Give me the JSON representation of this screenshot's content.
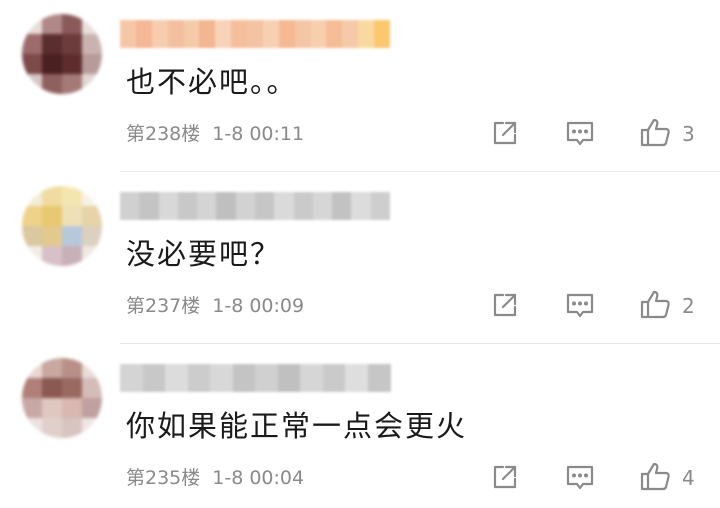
{
  "comments": [
    {
      "text": "也不必吧。。",
      "floor": "第238楼",
      "time": "1-8 00:11",
      "likes": "3",
      "avatar_colors": [
        "#e8dcd8",
        "#b08888",
        "#8a5a5a",
        "#e9e0dd",
        "#9d6b6b",
        "#5a2e2e",
        "#6b3c3c",
        "#c9b3b0",
        "#7d4a4a",
        "#4a2020",
        "#5e2c2c",
        "#b79b98",
        "#d8c8c5",
        "#8f6060",
        "#a47a78",
        "#e2d6d4"
      ],
      "name_colors": [
        "#f6c7a6",
        "#f4b896",
        "#f7cdb0",
        "#f3c09f",
        "#f5caa9",
        "#f2b690",
        "#f8d3b8",
        "#f6bf9b",
        "#f4c3a3",
        "#f7d0b3",
        "#f5b994",
        "#f3c6a6",
        "#f8cfae",
        "#f4bd98",
        "#f6c9a8",
        "#f9d9a0",
        "#fbc870"
      ]
    },
    {
      "text": "没必要吧？",
      "floor": "第237楼",
      "time": "1-8 00:09",
      "likes": "2",
      "avatar_colors": [
        "#f4ecd8",
        "#f0dca0",
        "#f5e6b0",
        "#f7f1e6",
        "#eed28a",
        "#e8c870",
        "#f0e0b8",
        "#e6d3a8",
        "#d9c8a0",
        "#e2c98e",
        "#b8c8dc",
        "#dcd0c0",
        "#f2ece4",
        "#d8c0c8",
        "#c8b0b8",
        "#efe8e0"
      ],
      "name_colors": [
        "#d0d0d0",
        "#c4c4c4",
        "#d8d8d8",
        "#c8c8c8",
        "#d4d4d4",
        "#bfbfbf",
        "#d2d2d2",
        "#c6c6c6",
        "#dadada",
        "#cacaca",
        "#d6d6d6",
        "#c2c2c2",
        "#dcdcdc",
        "#cecece"
      ]
    },
    {
      "text": "你如果能正常一点会更火",
      "floor": "第235楼",
      "time": "1-8 00:04",
      "likes": "4",
      "avatar_colors": [
        "#ead8d4",
        "#c8a8a0",
        "#b89088",
        "#e8dcd8",
        "#b08078",
        "#8a5a52",
        "#9a6a60",
        "#d4bcb8",
        "#c8a8a4",
        "#e0c8c0",
        "#d8b8b0",
        "#c0a0a0",
        "#ece2e0",
        "#e0d0cc",
        "#d8c4c0",
        "#eee6e4"
      ],
      "name_colors": [
        "#d4d4d4",
        "#c8c8c8",
        "#dcdcdc",
        "#cccccc",
        "#d8d8d8",
        "#c4c4c4",
        "#d0d0d0",
        "#c0c0c0",
        "#d6d6d6",
        "#cacaca",
        "#dedede",
        "#c6c6c6"
      ]
    }
  ]
}
